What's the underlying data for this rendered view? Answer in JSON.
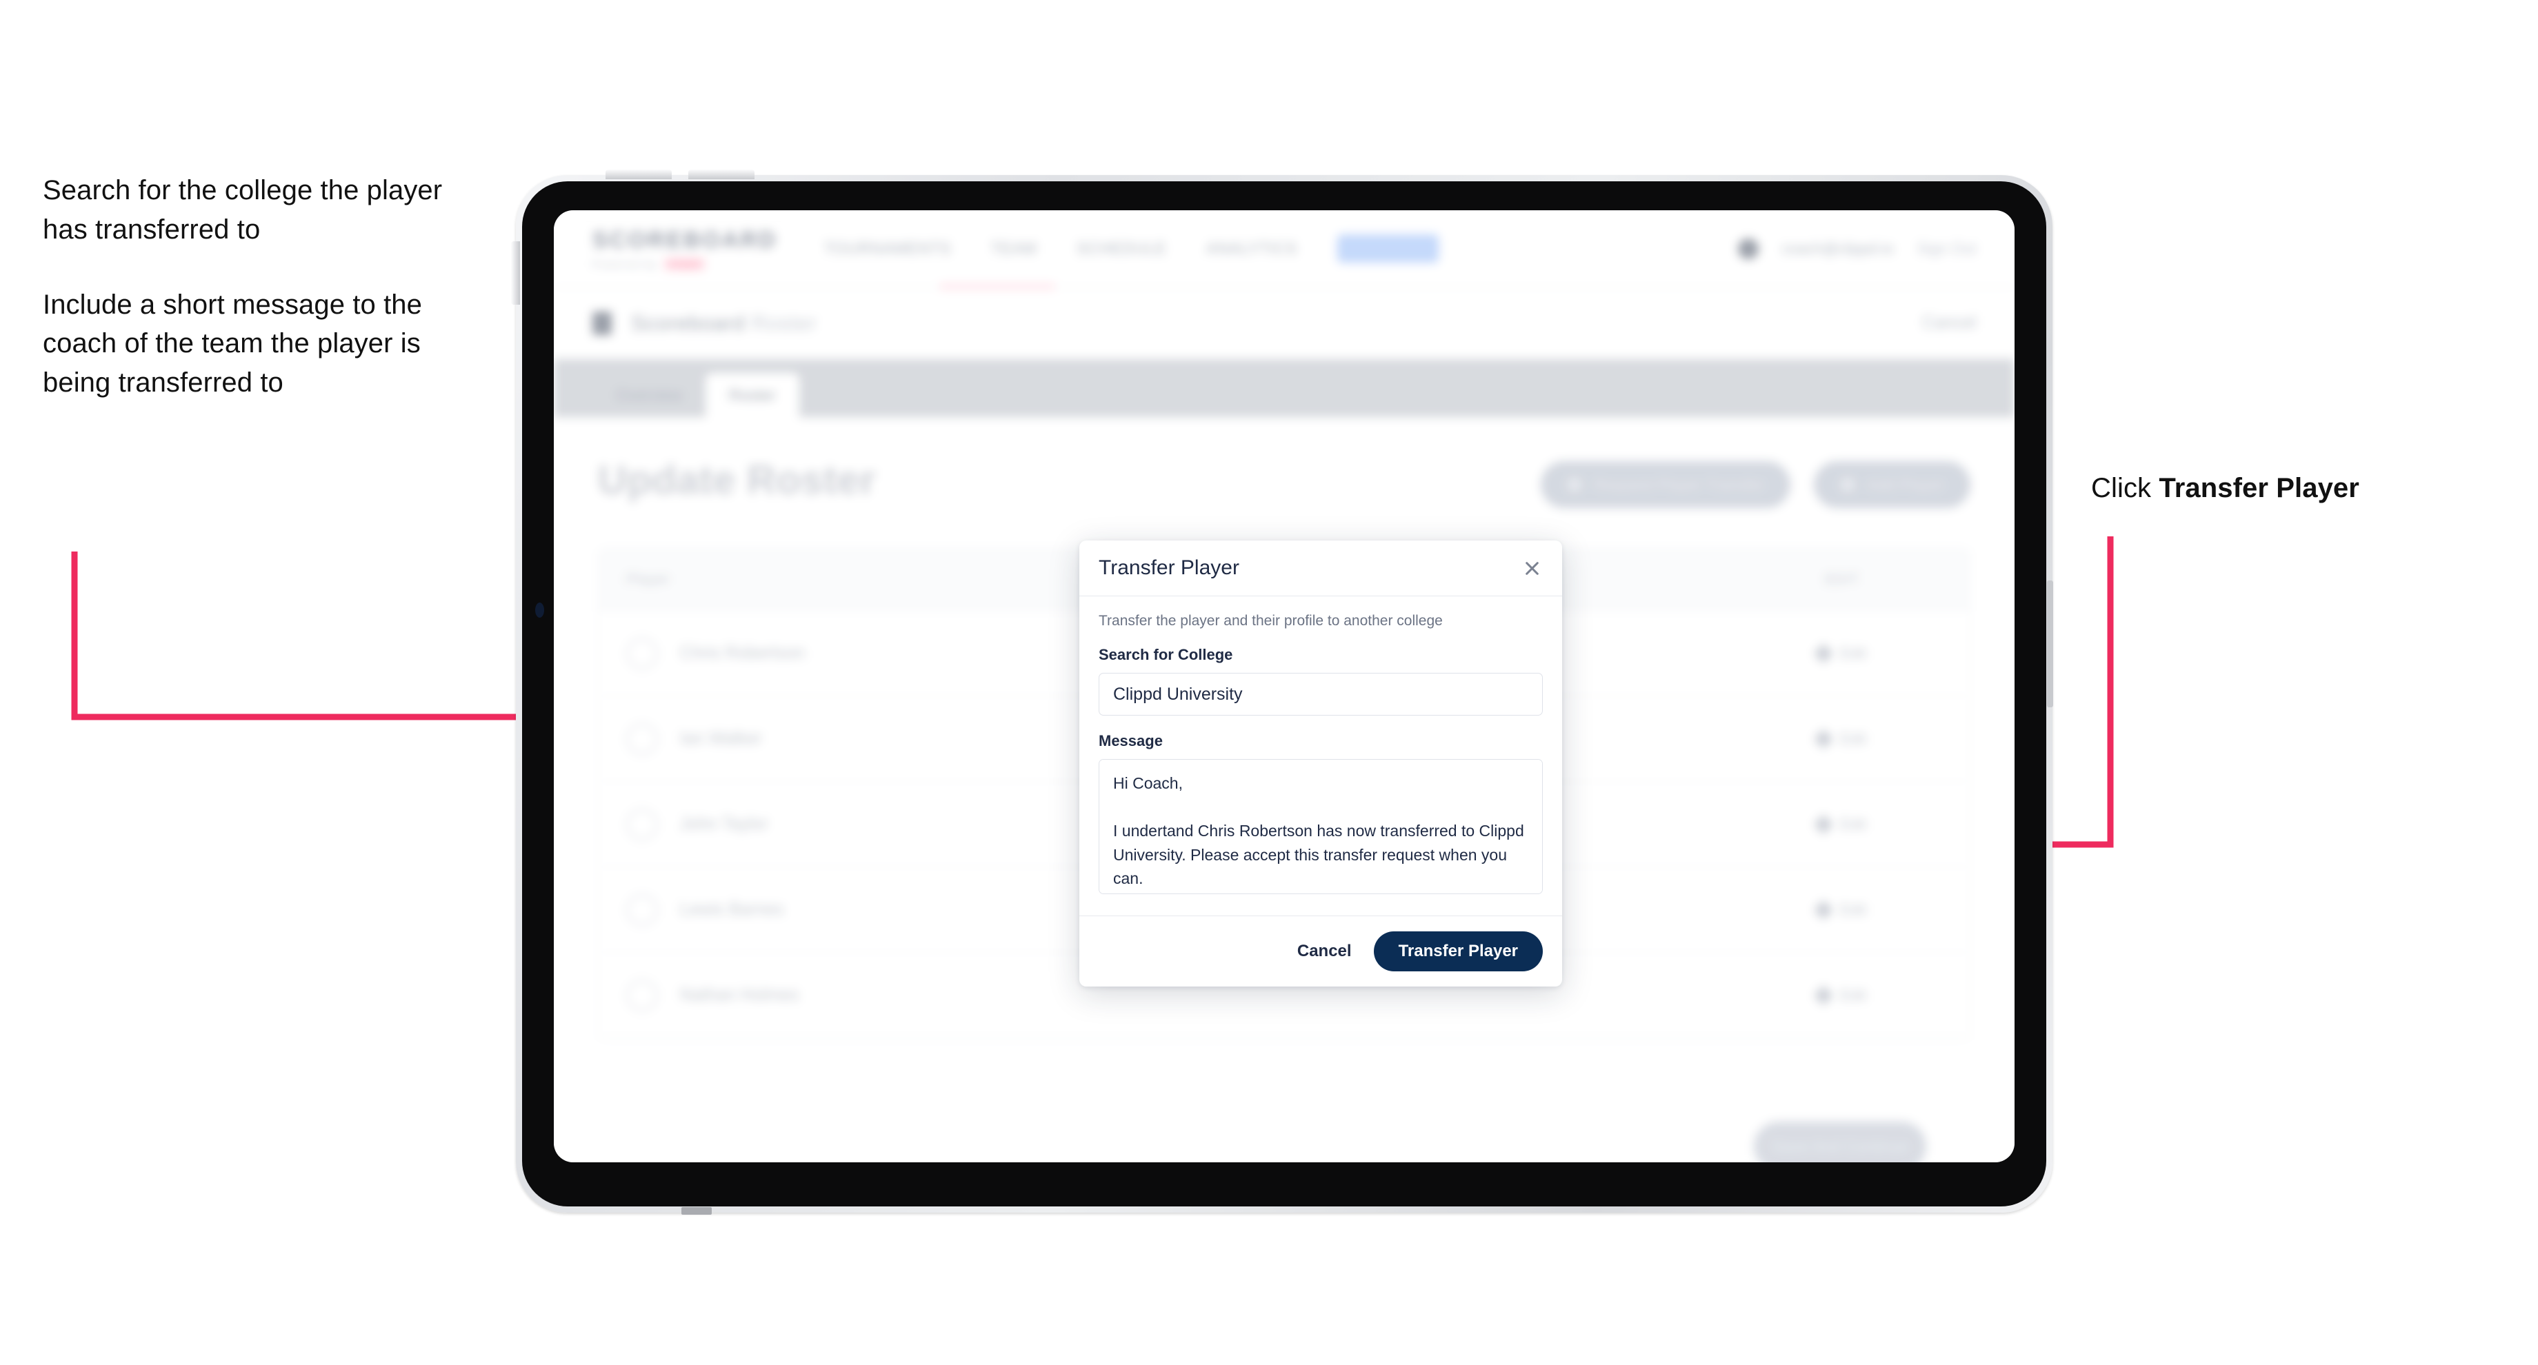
{
  "annotations": {
    "left": [
      "Search for the college the player has transferred to",
      "Include a short message to the coach of the team the player is being transferred to"
    ],
    "right_prefix": "Click ",
    "right_bold": "Transfer Player"
  },
  "colors": {
    "arrow_pink": "#EE2B5E",
    "primary_navy": "#0B2D55",
    "modal_text": "#1F2A44"
  },
  "app": {
    "brand": {
      "name": "SCOREBOARD",
      "sub": "Powered by",
      "pill": "clippd"
    },
    "nav": {
      "links": [
        "TOURNAMENTS",
        "TEAM",
        "SCHEDULE",
        "ANALYTICS"
      ],
      "pill_link": "ROSTER",
      "user": "coach@clippd.io",
      "signout": "Sign Out"
    },
    "breadcrumb": {
      "text": "Scoreboard",
      "muted": "Roster",
      "right": "Cancel"
    },
    "tabs": [
      {
        "label": "Overview",
        "active": false
      },
      {
        "label": "Roster",
        "active": true
      }
    ],
    "page_title": "Update Roster",
    "head_actions": [
      "Request Player Transfer",
      "Add Player"
    ],
    "table": {
      "columns": [
        "Player",
        "EDIT"
      ],
      "rows": [
        {
          "name": "Chris Robertson",
          "action": "Edit"
        },
        {
          "name": "Ian Walker",
          "action": "Edit"
        },
        {
          "name": "John Taylor",
          "action": "Edit"
        },
        {
          "name": "Lewis Barnes",
          "action": "Edit"
        },
        {
          "name": "Nathan Holmes",
          "action": "Edit"
        }
      ]
    },
    "footer_button": "Save And Continue"
  },
  "modal": {
    "title": "Transfer Player",
    "subtitle": "Transfer the player and their profile to another college",
    "college_label": "Search for College",
    "college_value": "Clippd University",
    "college_placeholder": "Search for College",
    "message_label": "Message",
    "message_value": "Hi Coach,\n\nI undertand Chris Robertson has now transferred to Clippd University. Please accept this transfer request when you can.",
    "message_placeholder": "Message",
    "cancel_label": "Cancel",
    "submit_label": "Transfer Player"
  }
}
